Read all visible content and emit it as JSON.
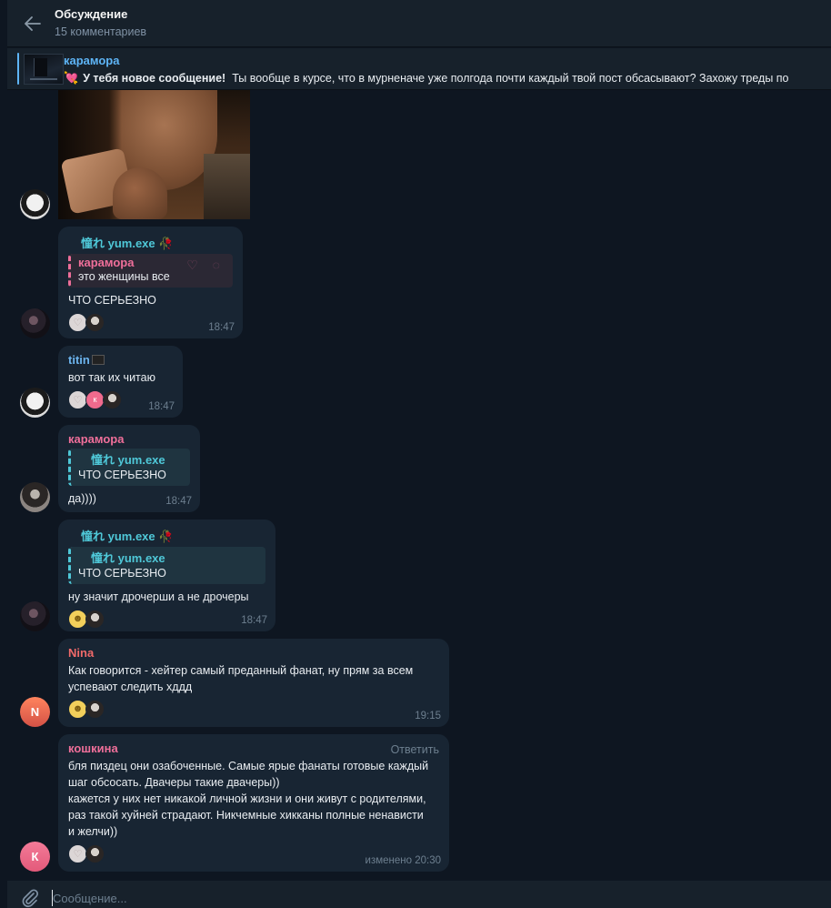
{
  "header": {
    "title": "Обсуждение",
    "subtitle": "15 комментариев"
  },
  "pinned": {
    "name": "карамора",
    "bold": "У тебя новое сообщение!",
    "text": "Ты вообще в курсе, что в мурненаче уже полгода почти каждый твой пост обсасывают? Захожу треды по"
  },
  "messages": [
    {
      "sender": "憧れ yum.exe",
      "quote_name": "карамора",
      "quote_text": "это женщины все",
      "text": "ЧТО СЕРЬЕЗНО",
      "time": "18:47"
    },
    {
      "sender": "titin",
      "text": "вот так их читаю",
      "time": "18:47",
      "reaction_letter": "к"
    },
    {
      "sender": "карамора",
      "quote_name": "憧れ yum.exe",
      "quote_text": "ЧТО СЕРЬЕЗНО",
      "text": "да))))",
      "time": "18:47"
    },
    {
      "sender": "憧れ yum.exe",
      "quote_name": "憧れ yum.exe",
      "quote_text": "ЧТО СЕРЬЕЗНО",
      "text": "ну значит дрочерши а не дрочеры",
      "time": "18:47"
    },
    {
      "sender": "Nina",
      "text": "Как говорится - хейтер самый преданный фанат, ну прям за всем успевают следить хддд",
      "time": "19:15",
      "avatar_letter": "N"
    },
    {
      "sender": "кошкина",
      "reply_label": "Ответить",
      "text": "бля пиздец они озабоченные. Самые ярые фанаты готовые каждый шаг обсосать. Двачеры такие двачеры))\nкажется у них нет никакой личной жизни и они живут с родителями, раз такой хуйней страдают. Никчемные хикканы полные ненависти и желчи))",
      "time": "изменено 20:30",
      "avatar_letter": "К"
    }
  ],
  "composer": {
    "placeholder": "Сообщение..."
  },
  "colors": {
    "background": "#0e1621",
    "bubble": "#182533",
    "accent": "#5eb5f7"
  }
}
